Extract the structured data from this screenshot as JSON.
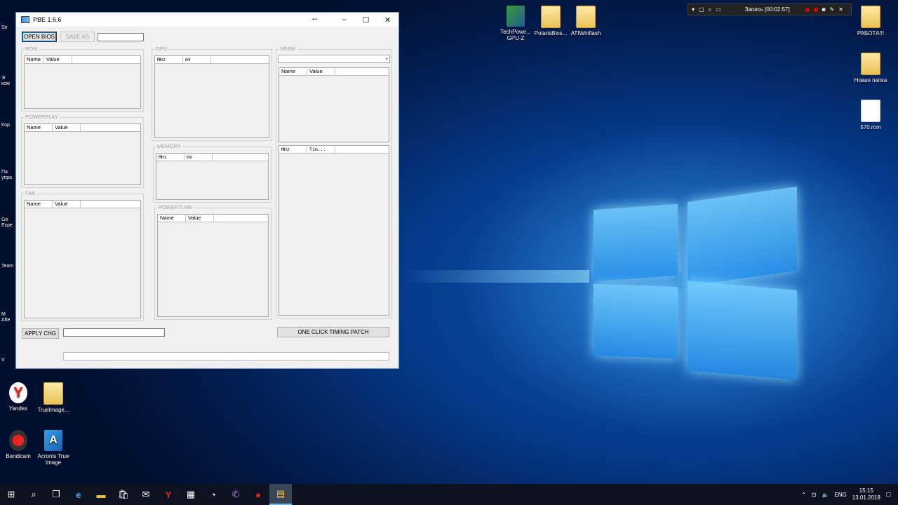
{
  "desktop": {
    "icons": [
      {
        "label": "TechPowe... GPU-Z"
      },
      {
        "label": "PolarisBios..."
      },
      {
        "label": "ATIWinflash"
      },
      {
        "label": "РАБОТА!!!"
      },
      {
        "label": "Новая папка"
      },
      {
        "label": "570.rom"
      },
      {
        "label": "Yandex"
      },
      {
        "label": "TrueImage..."
      },
      {
        "label": "Bandicam"
      },
      {
        "label": "Acronis True Image"
      }
    ],
    "left_strip": [
      "Se",
      "Э ком",
      "Кор",
      "Па упра",
      "Ge Expe",
      "Team",
      "M Afte",
      "V"
    ]
  },
  "recorder": {
    "label": "Запись [00:02:57]"
  },
  "window": {
    "title": "PBE 1.6.6",
    "open_bios": "OPEN BIOS",
    "save_as": "SAVE AS",
    "apply": "APPLY CHG",
    "timing_patch": "ONE CLICK TIMING PATCH",
    "groups": {
      "rom": {
        "label": "ROM",
        "cols": [
          "Name",
          "Value",
          ""
        ]
      },
      "powerplay": {
        "label": "POWERPLAY",
        "cols": [
          "Name",
          "Value",
          ""
        ]
      },
      "fan": {
        "label": "FAN",
        "cols": [
          "Name",
          "Value",
          ""
        ]
      },
      "gpu": {
        "label": "GPU",
        "cols": [
          "MHz",
          "mV",
          ""
        ]
      },
      "memory": {
        "label": "MEMORY",
        "cols": [
          "MHz",
          "mV",
          ""
        ]
      },
      "powertune": {
        "label": "POWERTUNE",
        "cols": [
          "Name",
          "Value",
          ""
        ]
      },
      "vram": {
        "label": "VRAM",
        "cols": [
          "Name",
          "Value",
          ""
        ],
        "timing_cols": [
          "MHz",
          "Tim...",
          ""
        ]
      }
    }
  },
  "taskbar": {
    "lang": "ENG",
    "time": "15:15",
    "date": "13.01.2018"
  }
}
